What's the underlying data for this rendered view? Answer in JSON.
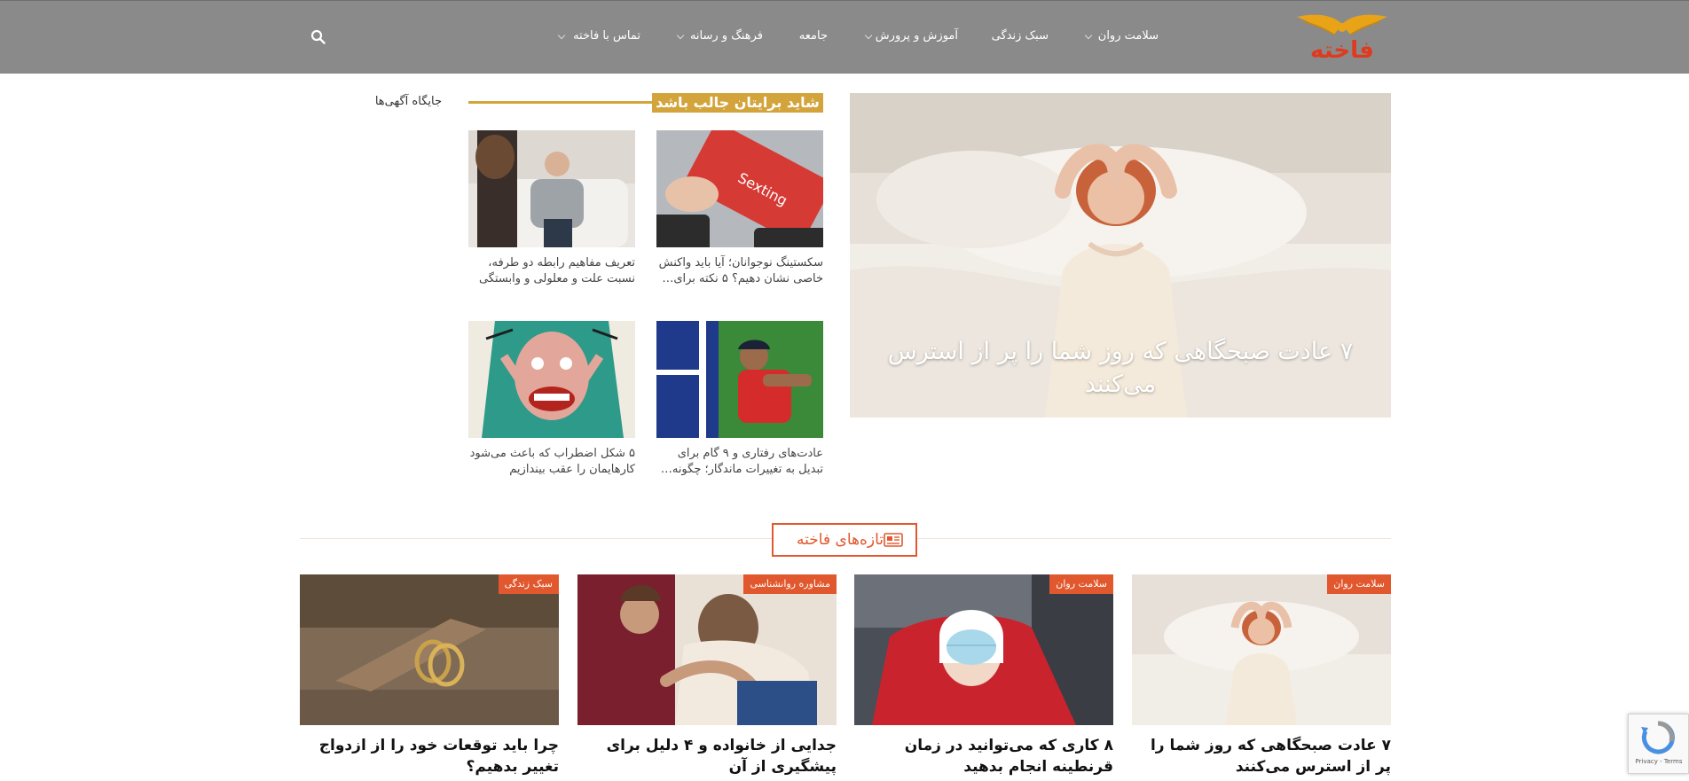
{
  "header": {
    "logo_text": "فاخته",
    "nav": [
      {
        "label": "سلامت روان",
        "has_dropdown": true
      },
      {
        "label": "سبک زندگی",
        "has_dropdown": false
      },
      {
        "label": "آموزش و پرورش",
        "has_dropdown": true
      },
      {
        "label": "جامعه",
        "has_dropdown": false
      },
      {
        "label": "فرهنگ و رسانه",
        "has_dropdown": true
      },
      {
        "label": "تماس با فاخته",
        "has_dropdown": true
      }
    ],
    "search_icon": "search-icon",
    "background": "#8a8a8a"
  },
  "hero": {
    "title": "۷ عادت صبحگاهی که روز شما را پر از استرس می‌کنند"
  },
  "suggestions": {
    "title": "شاید برایتان جالب باشد",
    "ads_label": "جایگاه آگهی‌ها",
    "items": [
      {
        "caption": "سکستینگ نوجوانان؛ آیا باید واکنش خاصی نشان دهیم؟ ۵ نکته برای…",
        "image_text": "Sexting"
      },
      {
        "caption": "تعریف مفاهیم رابطه دو طرفه، نسبت علت و معلولی و وابستگی"
      },
      {
        "caption": "عادت‌های رفتاری و ۹ گام برای تبدیل به تغییرات ماندگار؛ چگونه…"
      },
      {
        "caption": "۵ شکل اضطراب که باعث می‌شود کارهایمان را عقب بیندازیم"
      }
    ]
  },
  "latest": {
    "title": "تازه‌های فاخته",
    "icon": "newspaper-icon",
    "cards": [
      {
        "category": "سلامت روان",
        "title": "۷ عادت صبحگاهی که روز شما را پر از استرس می‌کنند"
      },
      {
        "category": "سلامت روان",
        "title": "۸ کاری که می‌توانید در زمان قرنطینه انجام بدهید"
      },
      {
        "category": "مشاوره روانشناسی",
        "title": "جدایی از خانواده و ۴ دلیل برای پیشگیری از آن"
      },
      {
        "category": "سبک زندگی",
        "title": "چرا باید توقعات خود را از ازدواج تغییر بدهیم؟"
      }
    ]
  },
  "recaptcha": {
    "text": "Privacy - Terms"
  },
  "colors": {
    "accent": "#e1582e",
    "gold": "#d4a43c"
  }
}
